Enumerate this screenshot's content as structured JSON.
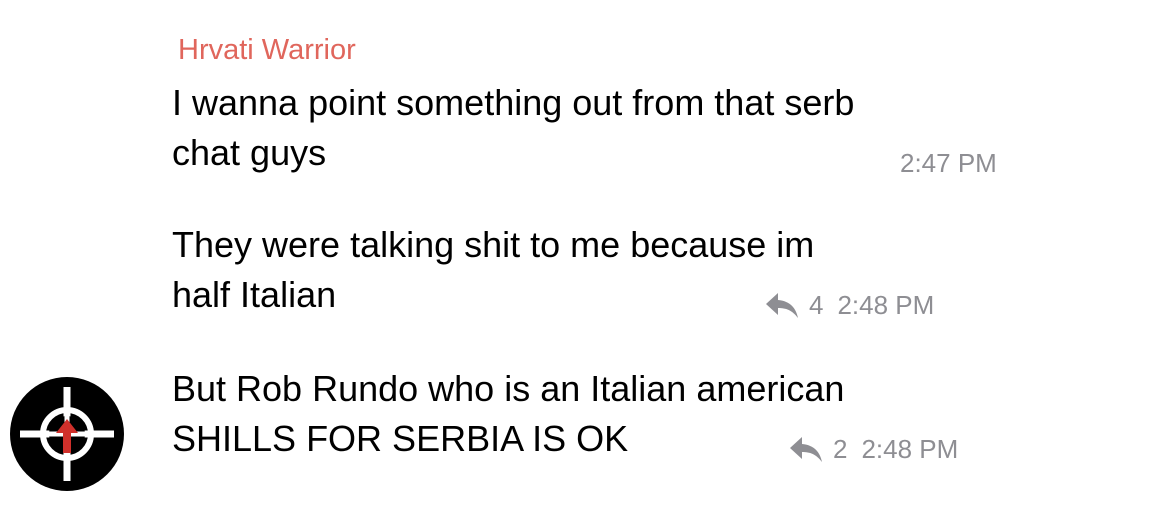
{
  "messages": [
    {
      "sender": "Hrvati Warrior",
      "lines": [
        "I wanna point something out from that serb",
        "chat guys"
      ],
      "time": "2:47 PM"
    },
    {
      "lines": [
        "They were talking shit to me because im",
        "half Italian"
      ],
      "replies": "4",
      "time": "2:48 PM"
    },
    {
      "lines": [
        "But Rob Rundo who is an Italian american",
        "SHILLS FOR SERBIA IS OK"
      ],
      "replies": "2",
      "time": "2:48 PM"
    }
  ],
  "icons": {
    "reply": "reply-arrow-icon",
    "avatar": "celtic-cross-avatar"
  },
  "colors": {
    "sender_name": "#e0665c",
    "meta_text": "#8e8e93",
    "avatar_bg": "#000000",
    "avatar_accent": "#d0302b"
  }
}
